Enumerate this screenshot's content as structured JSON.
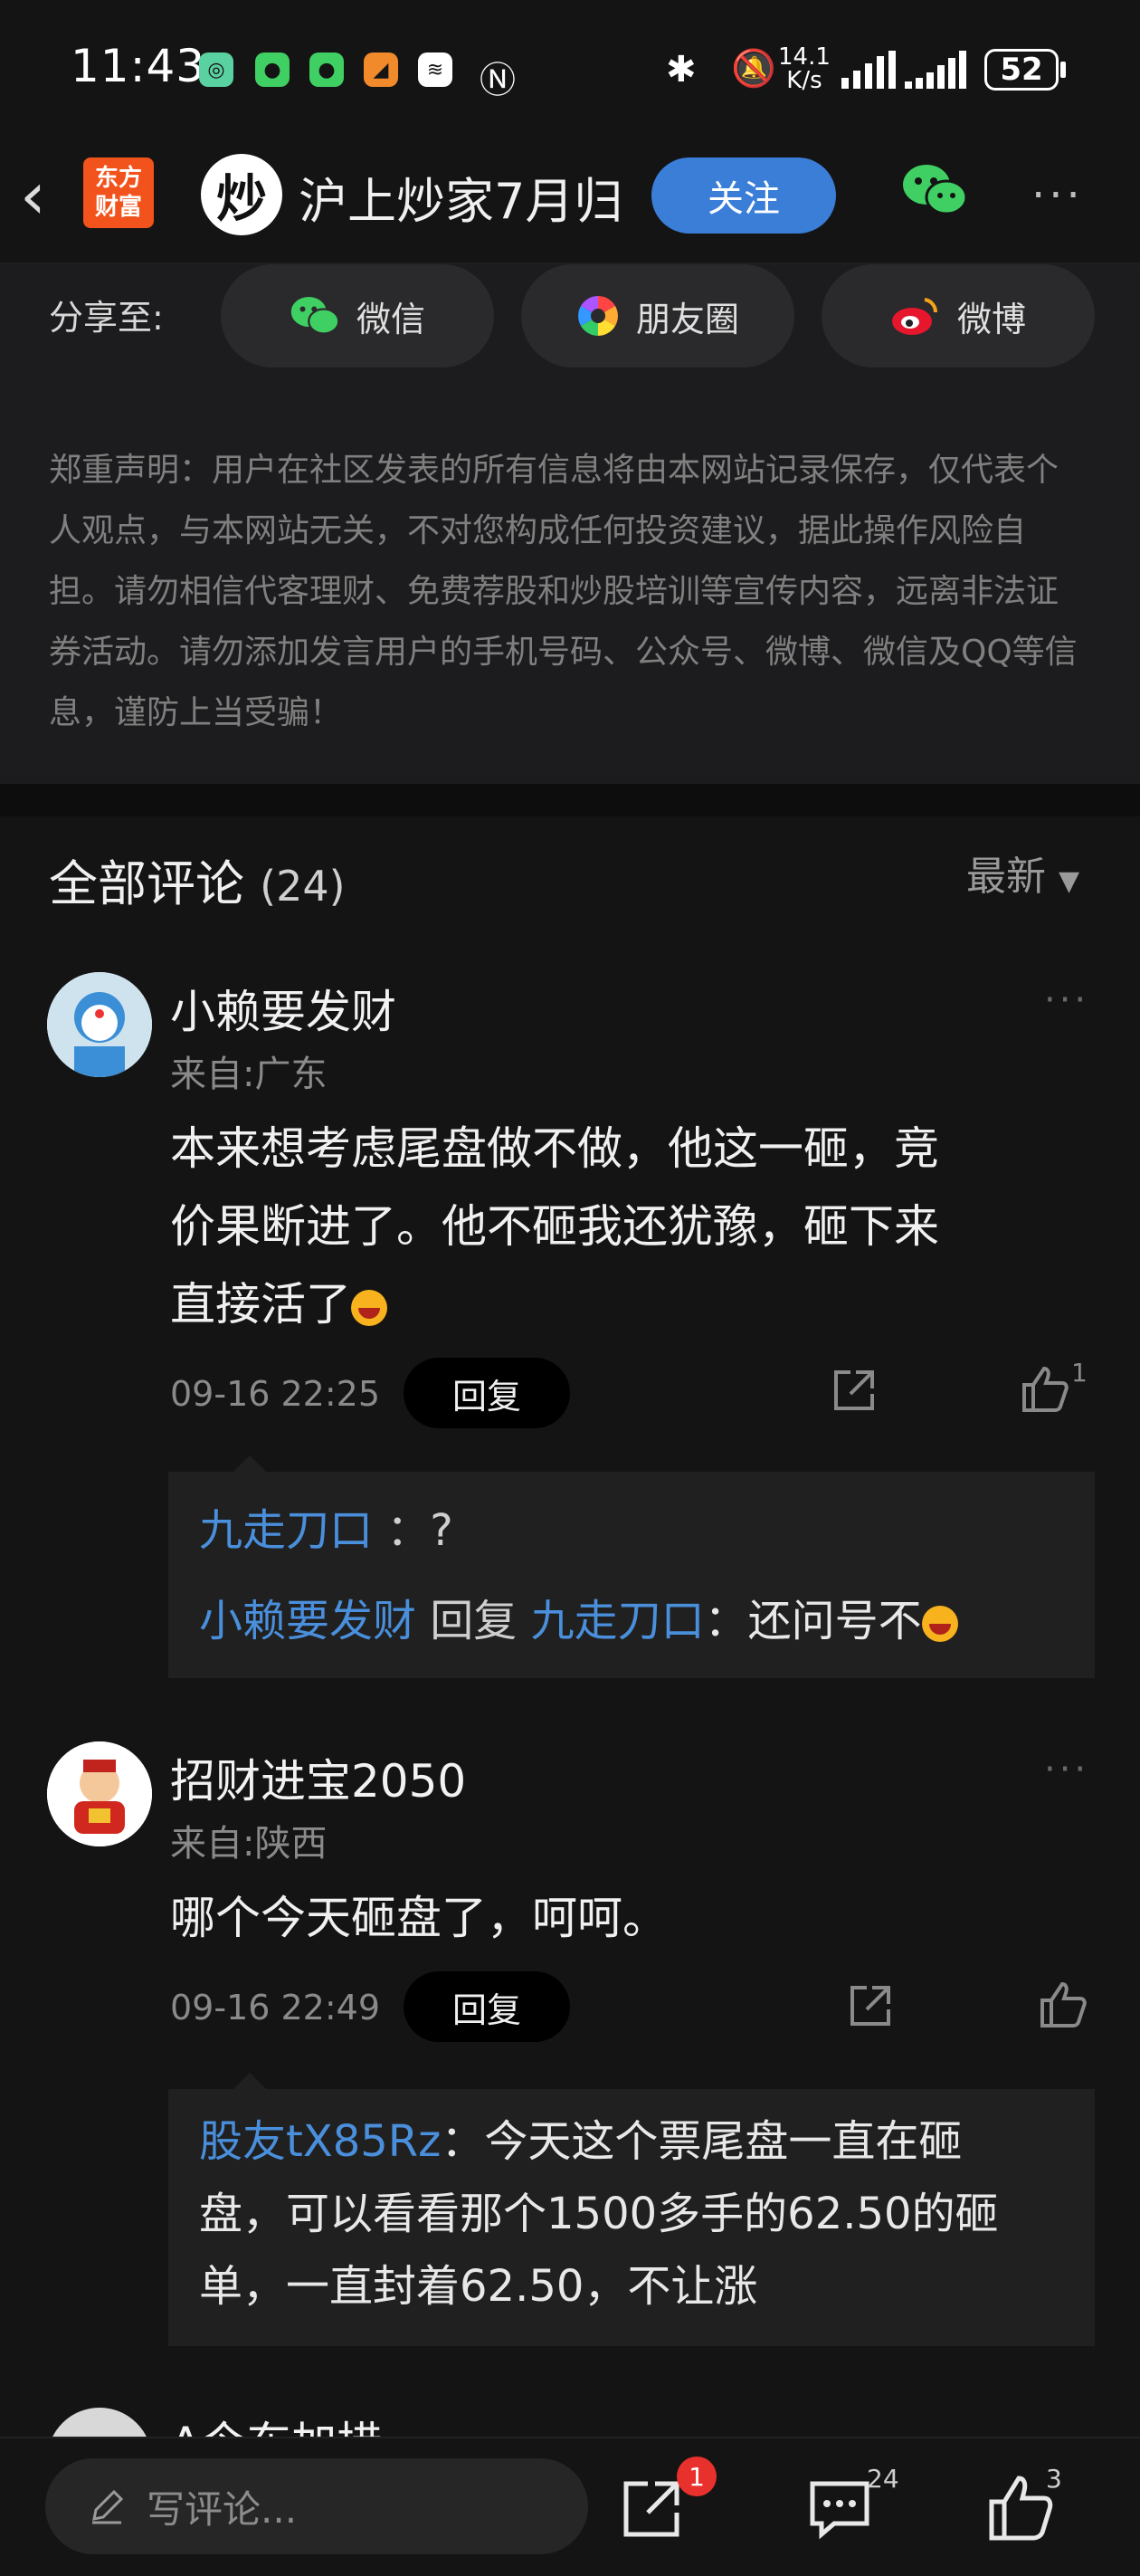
{
  "status_bar": {
    "time": "11:43",
    "net_speed_value": "14.1",
    "net_speed_unit": "K/s",
    "battery": "52"
  },
  "header": {
    "app_logo_line1": "东方",
    "app_logo_line2": "财富",
    "avatar_char": "炒",
    "title": "沪上炒家7月归",
    "follow_label": "关注"
  },
  "share": {
    "label": "分享至:",
    "options": [
      {
        "label": "微信",
        "icon": "wechat-icon"
      },
      {
        "label": "朋友圈",
        "icon": "moments-icon"
      },
      {
        "label": "微博",
        "icon": "weibo-icon"
      }
    ]
  },
  "disclaimer": "郑重声明：用户在社区发表的所有信息将由本网站记录保存，仅代表个人观点，与本网站无关，不对您构成任何投资建议，据此操作风险自担。请勿相信代客理财、免费荐股和炒股培训等宣传内容，远离非法证券活动。请勿添加发言用户的手机号码、公众号、微博、微信及QQ等信息，谨防上当受骗！",
  "comments_section": {
    "title": "全部评论",
    "count": "(24)",
    "sort_label": "最新"
  },
  "comments": [
    {
      "author": "小赖要发财",
      "from": "来自:广东",
      "body_line1": "本来想考虑尾盘做不做，他这一砸，竞",
      "body_line2": "价果断进了。他不砸我还犹豫，砸下来",
      "body_line3": "直接活了",
      "time": "09-16 22:25",
      "reply_label": "回复",
      "likes": "1",
      "replies": [
        {
          "author": "九走刀口",
          "text": "：?"
        },
        {
          "author": "小赖要发财",
          "mid": "回复",
          "target": "九走刀口",
          "text": "：还问号不"
        }
      ]
    },
    {
      "author": "招财进宝2050",
      "from": "来自:陕西",
      "body_line1": "哪个今天砸盘了，呵呵。",
      "time": "09-16 22:49",
      "reply_label": "回复",
      "replies": [
        {
          "author": "股友tX85Rz",
          "text_line1": "：今天这个票尾盘一直在砸",
          "text_line2": "盘，可以看看那个1500多手的62.50的砸",
          "text_line3": "单，一直封着62.50，不让涨"
        }
      ]
    },
    {
      "author": "A今东加措"
    }
  ],
  "bottom_bar": {
    "input_placeholder": "写评论...",
    "share_badge": "1",
    "comment_count": "24",
    "like_count": "3"
  }
}
